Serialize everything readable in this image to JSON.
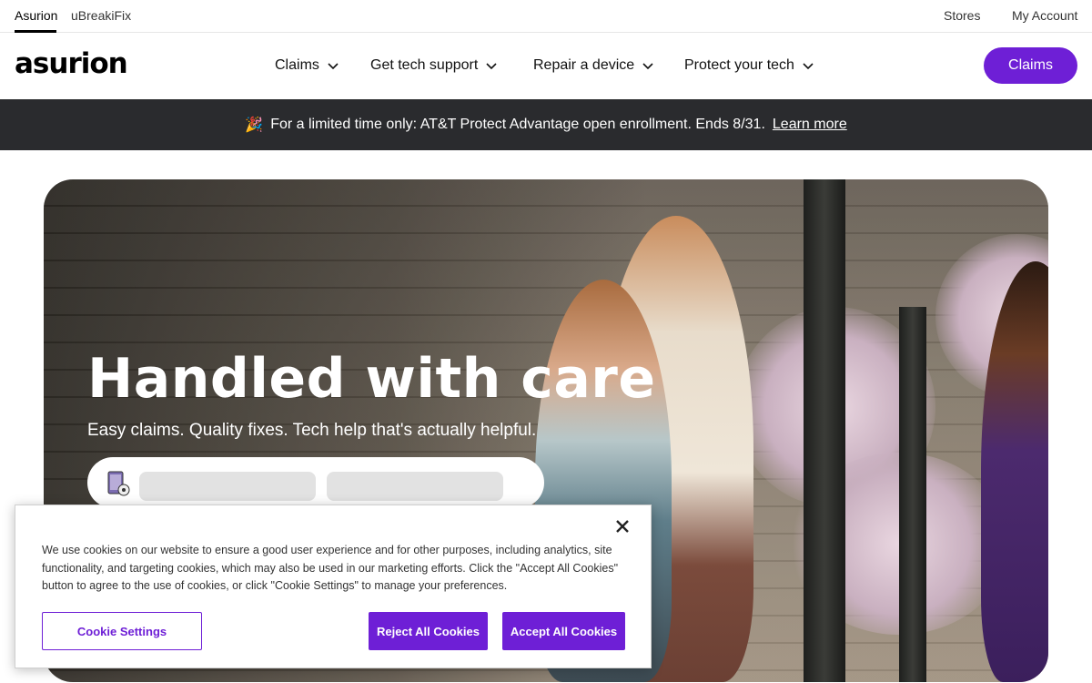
{
  "util": {
    "asurion": "Asurion",
    "ubreakifix": "uBreakiFix",
    "stores": "Stores",
    "my_account": "My Account"
  },
  "nav": {
    "logo": "asurion",
    "items": [
      {
        "label": "Claims"
      },
      {
        "label": "Get tech support"
      },
      {
        "label": "Repair a device"
      },
      {
        "label": "Protect your tech"
      }
    ],
    "cta": "Claims",
    "accent": "#6e1fd6"
  },
  "promo": {
    "emoji": "🎉",
    "text": "For a limited time only: AT&T Protect Advantage open enrollment. Ends 8/31.",
    "link": "Learn more",
    "background": "#2a2b2e"
  },
  "hero": {
    "title": "Handled with care",
    "subtitle": "Easy claims. Quality fixes. Tech help that's actually helpful."
  },
  "cookie": {
    "text": "We use cookies on our website to ensure a good user experience and for other purposes, including analytics, site functionality, and targeting cookies, which may also be used in our marketing efforts. Click the \"Accept All Cookies\" button to agree to the use of cookies, or click \"Cookie Settings\" to manage your preferences.",
    "settings_label": "Cookie Settings",
    "reject_label": "Reject All Cookies",
    "accept_label": "Accept All Cookies",
    "close_icon": "close-icon"
  }
}
